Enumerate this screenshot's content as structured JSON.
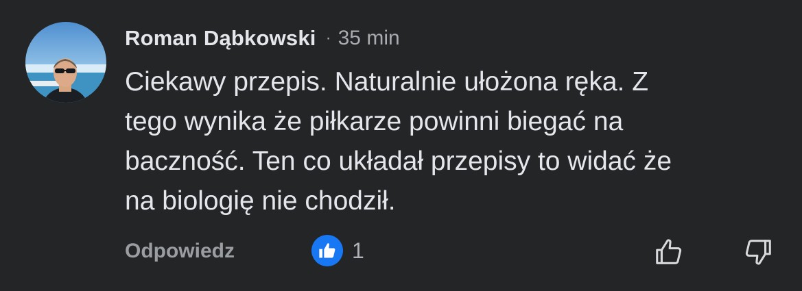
{
  "comment": {
    "author": "Roman Dąbkowski",
    "separator": "·",
    "time": "35 min",
    "text_lines": [
      "Ciekawy przepis. Naturalnie ułożona ręka. Z",
      "tego wynika że piłkarze powinni biegać na",
      "baczność. Ten co układał przepisy to widać że",
      "na biologię nie chodził."
    ],
    "avatar_icon": "profile-photo"
  },
  "actions": {
    "reply_label": "Odpowiedz",
    "reaction_icon": "like-thumb-icon",
    "reaction_count": "1",
    "upvote_icon": "thumbs-up-outline-icon",
    "downvote_icon": "thumbs-down-outline-icon"
  },
  "colors": {
    "background": "#242526",
    "primary_text": "#e4e6eb",
    "secondary_text": "#a8abaf",
    "like_blue": "#1877f2"
  }
}
